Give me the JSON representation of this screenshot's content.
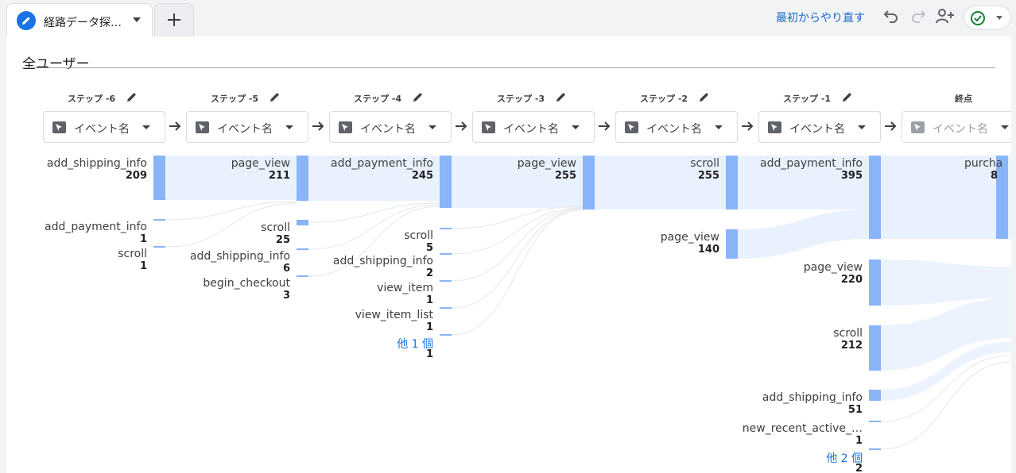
{
  "tab": {
    "title": "経路データ探…",
    "icon": "pencil-icon"
  },
  "toolbar": {
    "restart_label": "最初からやり直す",
    "icons": [
      "undo-icon",
      "redo-icon",
      "add-person-icon",
      "check-circle-icon"
    ]
  },
  "segment": {
    "label": "全ユーザー"
  },
  "steps": [
    {
      "label": "ステップ -6",
      "dimension": "イベント名"
    },
    {
      "label": "ステップ -5",
      "dimension": "イベント名"
    },
    {
      "label": "ステップ -4",
      "dimension": "イベント名"
    },
    {
      "label": "ステップ -3",
      "dimension": "イベント名"
    },
    {
      "label": "ステップ -2",
      "dimension": "イベント名"
    },
    {
      "label": "ステップ -1",
      "dimension": "イベント名"
    },
    {
      "label": "終点",
      "dimension": "イベント名"
    }
  ],
  "nodes": [
    [
      {
        "name": "add_shipping_info",
        "value": "209"
      },
      {
        "name": "add_payment_info",
        "value": "1"
      },
      {
        "name": "scroll",
        "value": "1"
      }
    ],
    [
      {
        "name": "page_view",
        "value": "211"
      },
      {
        "name": "scroll",
        "value": "25"
      },
      {
        "name": "add_shipping_info",
        "value": "6"
      },
      {
        "name": "begin_checkout",
        "value": "3"
      }
    ],
    [
      {
        "name": "add_payment_info",
        "value": "245"
      },
      {
        "name": "scroll",
        "value": "5"
      },
      {
        "name": "add_shipping_info",
        "value": "2"
      },
      {
        "name": "view_item",
        "value": "1"
      },
      {
        "name": "view_item_list",
        "value": "1"
      },
      {
        "name": "他 1 個",
        "value": "1"
      }
    ],
    [
      {
        "name": "page_view",
        "value": "255"
      }
    ],
    [
      {
        "name": "scroll",
        "value": "255"
      },
      {
        "name": "page_view",
        "value": "140"
      }
    ],
    [
      {
        "name": "add_payment_info",
        "value": "395"
      },
      {
        "name": "page_view",
        "value": "220"
      },
      {
        "name": "scroll",
        "value": "212"
      },
      {
        "name": "add_shipping_info",
        "value": "51"
      },
      {
        "name": "new_recent_active_…",
        "value": "1"
      },
      {
        "name": "他 2 個",
        "value": "2"
      }
    ],
    [
      {
        "name": "purcha",
        "value": "8"
      }
    ]
  ],
  "colors": {
    "accent": "#1a73e8",
    "node": "#8ab4f8",
    "flow": "#e8f0fe"
  }
}
